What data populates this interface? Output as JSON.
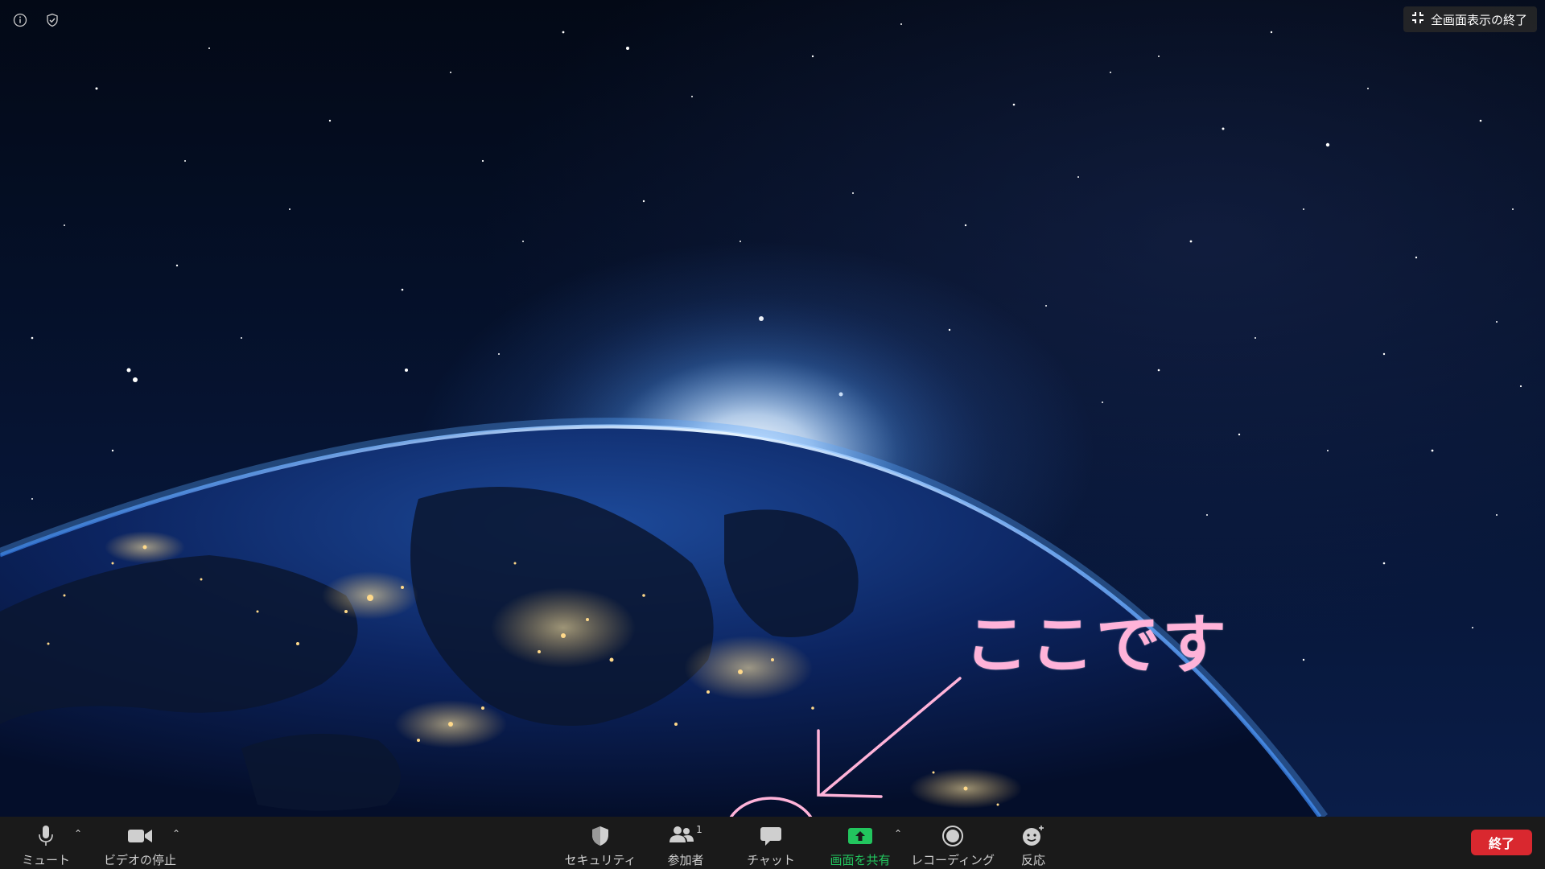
{
  "top_bar": {
    "exit_fullscreen_label": "全画面表示の終了"
  },
  "annotation": {
    "text": "ここです",
    "color": "#ffb3d9"
  },
  "toolbar": {
    "mute_label": "ミュート",
    "video_label": "ビデオの停止",
    "security_label": "セキュリティ",
    "participants_label": "参加者",
    "participants_count": "1",
    "chat_label": "チャット",
    "share_label": "画面を共有",
    "record_label": "レコーディング",
    "reactions_label": "反応",
    "end_label": "終了"
  },
  "colors": {
    "toolbar_bg": "#1a1a1a",
    "share_green": "#22c55e",
    "end_red": "#d9282f",
    "annotation_pink": "#ffb3d9"
  }
}
